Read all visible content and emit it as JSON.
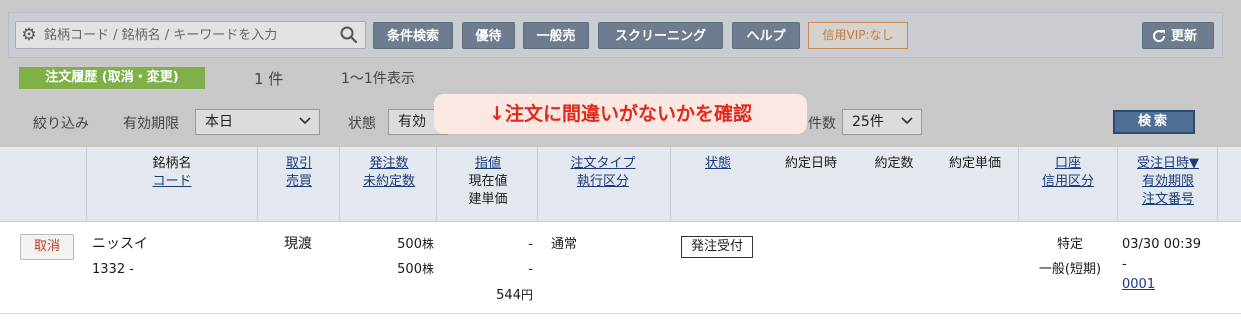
{
  "toolbar": {
    "search_placeholder": "銘柄コード / 銘柄名 / キーワードを入力",
    "buttons": [
      "条件検索",
      "優待",
      "一般売",
      "スクリーニング",
      "ヘルプ"
    ],
    "vip_label": "信用VIP:なし",
    "refresh_label": "更新"
  },
  "history": {
    "title": "注文履歴 (取消・変更)",
    "count": "1 件",
    "range": "1～1件表示"
  },
  "filter": {
    "narrow_label": "絞り込み",
    "period_label": "有効期限",
    "period_value": "本日",
    "status_label": "状態",
    "status_value": "有効",
    "perpage_label": "件数",
    "perpage_value": "25件",
    "search_label": "検索"
  },
  "banner": "↓注文に間違いがないかを確認",
  "table": {
    "headers": {
      "name_1": "銘柄名",
      "name_2": "コード",
      "trade_1": "取引",
      "trade_2": "売買",
      "qty_1": "発注数",
      "qty_2": "未約定数",
      "price_1": "指値",
      "price_2": "現在値",
      "price_3": "建単価",
      "type_1": "注文タイプ",
      "type_2": "執行区分",
      "status": "状態",
      "exec_date": "約定日時",
      "exec_qty": "約定数",
      "exec_price": "約定単価",
      "account_1": "口座",
      "account_2": "信用区分",
      "date_1": "受注日時▼",
      "date_2": "有効期限",
      "date_3": "注文番号"
    },
    "row": {
      "cancel": "取消",
      "name": "ニッスイ",
      "code": "1332 -",
      "trade": "現渡",
      "qty": "500",
      "qty_unit": "株",
      "unfilled": "500",
      "unfilled_unit": "株",
      "limit": "-",
      "current": "-",
      "cost": "544",
      "cost_unit": "円",
      "order_type": "通常",
      "status": "発注受付",
      "account": "特定",
      "credit": "一般(短期)",
      "received": "03/30 00:39",
      "expiry": "-",
      "order_no": "0001"
    }
  },
  "colors": {
    "toolbar_button": "#6d7c8f",
    "history_tag": "#7fb04a",
    "banner_text": "#e02a1e",
    "banner_bg": "#fbe8e2",
    "header_bg": "#e3e7ee"
  }
}
